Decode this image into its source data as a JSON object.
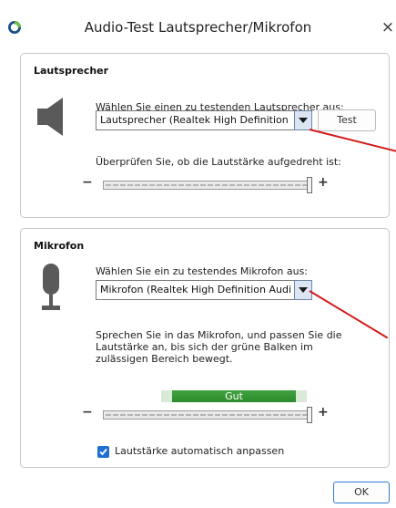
{
  "window": {
    "title": "Audio-Test Lautsprecher/Mikrofon",
    "close_glyph": "×",
    "app_icon": "app-icon"
  },
  "speaker": {
    "group_title": "Lautsprecher",
    "icon": "speaker-icon",
    "select_prompt": "Wählen Sie einen zu testenden Lautsprecher aus:",
    "selected_device": "Lautsprecher (Realtek High Definition Audio)",
    "test_label": "Test",
    "volume_prompt": "Überprüfen Sie, ob die Lautstärke aufgedreht ist:",
    "minus": "−",
    "plus": "+",
    "volume_fraction": 1.0
  },
  "microphone": {
    "group_title": "Mikrofon",
    "icon": "microphone-icon",
    "select_prompt": "Wählen Sie ein zu testendes Mikrofon aus:",
    "selected_device": "Mikrofon (Realtek High Definition Audio)",
    "description": "Sprechen Sie in das Mikrofon, und passen Sie die Lautstärke an, bis sich der grüne Balken im zulässigen Bereich bewegt.",
    "level_label": "Gut",
    "minus": "−",
    "plus": "+",
    "volume_fraction": 1.0,
    "auto_adjust_label": "Lautstärke automatisch anpassen",
    "auto_adjust_checked": true
  },
  "footer": {
    "ok_label": "OK"
  },
  "colors": {
    "accent": "#1f6fd1",
    "level_green": "#2c8a2c",
    "annotation_red": "#d21a1a"
  }
}
